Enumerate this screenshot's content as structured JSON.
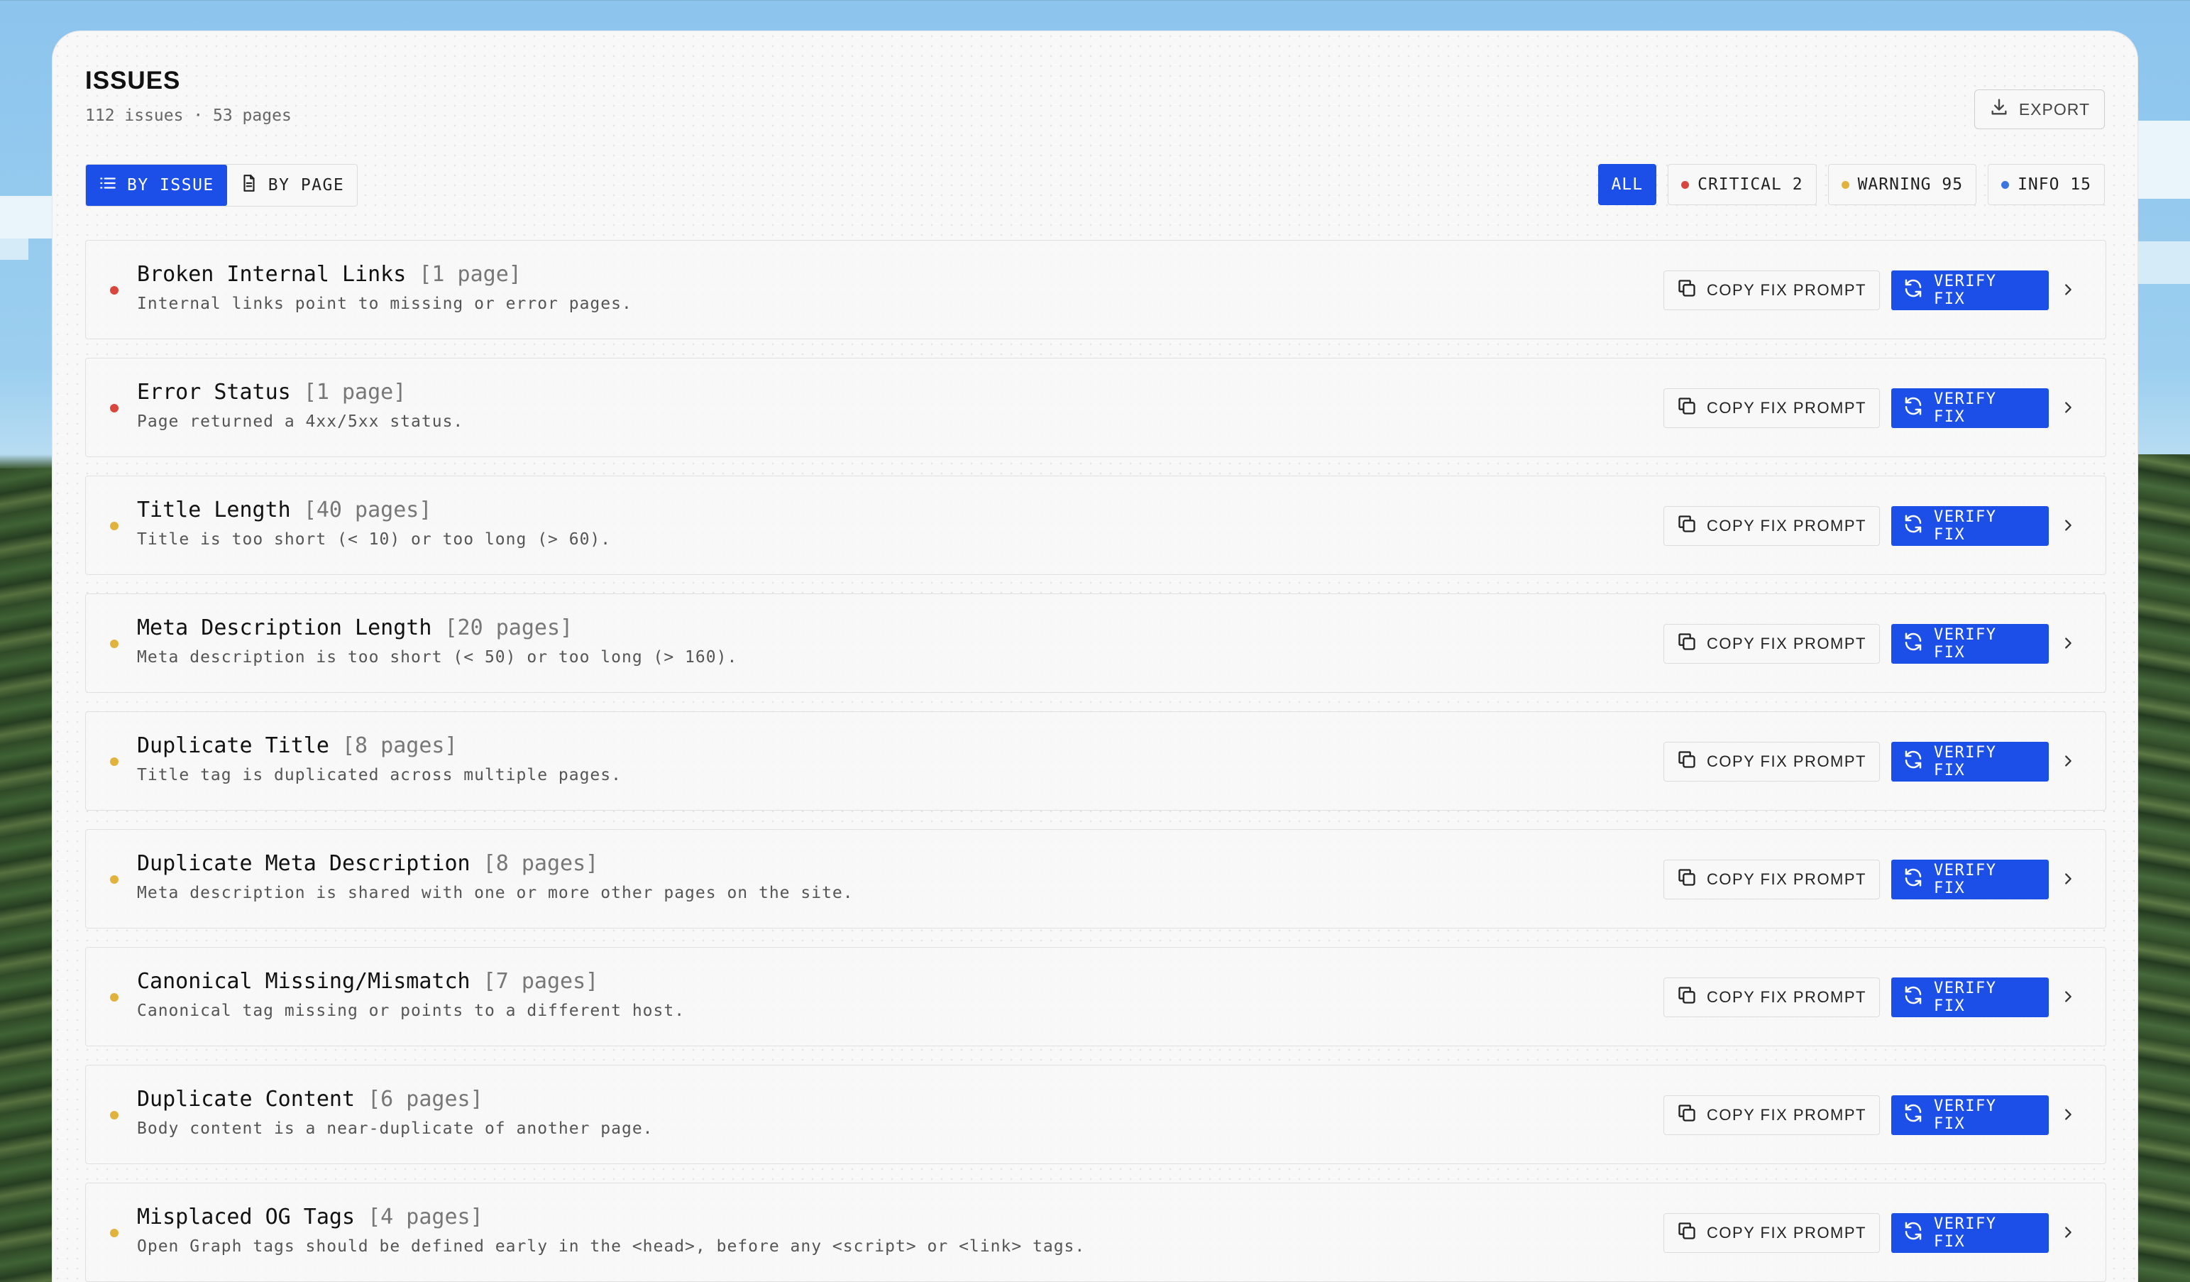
{
  "header": {
    "title": "ISSUES",
    "summary": "112 issues · 53 pages",
    "export_label": "EXPORT"
  },
  "view_toggle": {
    "by_issue_label": "BY ISSUE",
    "by_page_label": "BY PAGE",
    "active": "by_issue"
  },
  "filters": {
    "all_label": "ALL",
    "critical_label": "CRITICAL 2",
    "warning_label": "WARNING 95",
    "info_label": "INFO 15"
  },
  "colors": {
    "accent": "#1b4fe8",
    "critical": "#d9463e",
    "warning": "#e2b33c",
    "info": "#3b76e0"
  },
  "row_labels": {
    "copy_prompt": "COPY FIX PROMPT",
    "verify_fix": "VERIFY FIX"
  },
  "issues": [
    {
      "severity": "critical",
      "name": "Broken Internal Links",
      "count": "[1 page]",
      "description": "Internal links point to missing or error pages."
    },
    {
      "severity": "critical",
      "name": "Error Status",
      "count": "[1 page]",
      "description": "Page returned a 4xx/5xx status."
    },
    {
      "severity": "warning",
      "name": "Title Length",
      "count": "[40 pages]",
      "description": "Title is too short (< 10) or too long (> 60)."
    },
    {
      "severity": "warning",
      "name": "Meta Description Length",
      "count": "[20 pages]",
      "description": "Meta description is too short (< 50) or too long (> 160)."
    },
    {
      "severity": "warning",
      "name": "Duplicate Title",
      "count": "[8 pages]",
      "description": "Title tag is duplicated across multiple pages."
    },
    {
      "severity": "warning",
      "name": "Duplicate Meta Description",
      "count": "[8 pages]",
      "description": "Meta description is shared with one or more other pages on the site."
    },
    {
      "severity": "warning",
      "name": "Canonical Missing/Mismatch",
      "count": "[7 pages]",
      "description": "Canonical tag missing or points to a different host."
    },
    {
      "severity": "warning",
      "name": "Duplicate Content",
      "count": "[6 pages]",
      "description": "Body content is a near-duplicate of another page."
    },
    {
      "severity": "warning",
      "name": "Misplaced OG Tags",
      "count": "[4 pages]",
      "description": "Open Graph tags should be defined early in the <head>, before any <script> or <link> tags."
    }
  ]
}
